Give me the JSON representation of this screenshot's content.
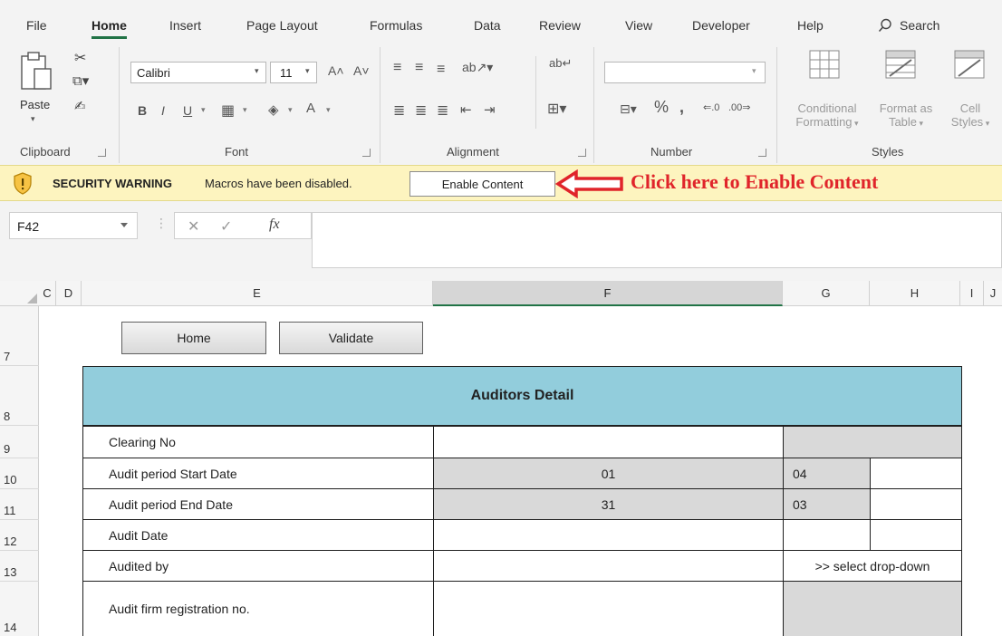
{
  "ribbon": {
    "tabs": [
      "File",
      "Home",
      "Insert",
      "Page Layout",
      "Formulas",
      "Data",
      "Review",
      "View",
      "Developer",
      "Help"
    ],
    "active_tab": "Home",
    "search_label": "Search",
    "clipboard": {
      "paste_label": "Paste",
      "group_label": "Clipboard"
    },
    "font": {
      "name": "Calibri",
      "size": "11",
      "group_label": "Font"
    },
    "alignment": {
      "group_label": "Alignment"
    },
    "number": {
      "format": "",
      "group_label": "Number"
    },
    "styles": {
      "conditional_label_1": "Conditional",
      "conditional_label_2": "Formatting",
      "format_as_label_1": "Format as",
      "format_as_label_2": "Table",
      "cell_label_1": "Cell",
      "cell_label_2": "Styles",
      "group_label": "Styles"
    }
  },
  "security_bar": {
    "title": "SECURITY WARNING",
    "message": "Macros have been disabled.",
    "button_label": "Enable Content",
    "annotation": "Click here to Enable Content",
    "bg_color": "#fdf4bf",
    "annotation_color": "#e0242a"
  },
  "formula_bar": {
    "name_box": "F42",
    "formula": ""
  },
  "grid": {
    "columns": [
      "C",
      "D",
      "E",
      "F",
      "G",
      "H",
      "I",
      "J"
    ],
    "selected_column": "F",
    "rows": [
      "7",
      "8",
      "9",
      "10",
      "11",
      "12",
      "13",
      "14"
    ],
    "macro_buttons": {
      "home": "Home",
      "validate": "Validate"
    }
  },
  "auditors_table": {
    "title": "Auditors Detail",
    "header_color": "#92cddc",
    "rows": [
      {
        "label": "Clearing No",
        "f": "",
        "g": "",
        "h": ""
      },
      {
        "label": "Audit period Start Date",
        "f": "01",
        "g": "04",
        "h": ""
      },
      {
        "label": "Audit period End Date",
        "f": "31",
        "g": "03",
        "h": ""
      },
      {
        "label": "Audit Date",
        "f": "",
        "g": "",
        "h": ""
      },
      {
        "label": "Audited by",
        "f": "",
        "gh": ">> select drop-down"
      },
      {
        "label": "Audit firm registration no.",
        "f": "",
        "gh": ""
      }
    ]
  }
}
